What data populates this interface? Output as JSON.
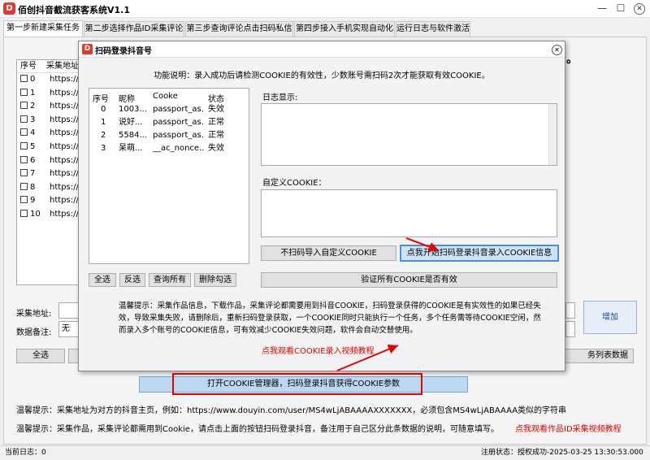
{
  "app": {
    "icon_letter": "D",
    "title": "佰创抖音截流获客系统V1.1"
  },
  "window_controls": {
    "minimize": "—",
    "maximize": "☐",
    "close": "✕"
  },
  "tabs": [
    {
      "label": "第一步新建采集任务",
      "active": true
    },
    {
      "label": "第二步选择作品ID采集评论",
      "active": false
    },
    {
      "label": "第三步查询评论点击扫码私信",
      "active": false
    },
    {
      "label": "第四步接入手机实现自动化",
      "active": false
    },
    {
      "label": "运行日志与软件激活",
      "active": false
    }
  ],
  "background": {
    "list_header": {
      "col_index": "序号",
      "col_url": "采集地址"
    },
    "list_rows": [
      {
        "index": "0",
        "url": "https://\\"
      },
      {
        "index": "1",
        "url": "https://\\"
      },
      {
        "index": "2",
        "url": "https://\\"
      },
      {
        "index": "3",
        "url": "https://\\"
      },
      {
        "index": "4",
        "url": "https://\\"
      },
      {
        "index": "5",
        "url": "https://\\"
      },
      {
        "index": "6",
        "url": "https://\\"
      },
      {
        "index": "7",
        "url": "https://\\"
      },
      {
        "index": "8",
        "url": "https://\\"
      },
      {
        "index": "9",
        "url": "https://\\"
      },
      {
        "index": "10",
        "url": "https://\\"
      }
    ],
    "dot": "。",
    "url_label": "采集地址:",
    "note_label": "数据备注:",
    "note_value": "无",
    "select_all": "全选",
    "list_data_button": "务列表数据",
    "add_button": "增加",
    "open_cookie_button": "打开COOKIE管理器，扫码登录抖音获得COOKIE参数",
    "hint1": "温馨提示：采集地址为对方的抖音主页，例如：https://www.douyin.com/user/MS4wLjABAAAAXXXXXXX，必须包含MS4wLjABAAAA类似的字符串",
    "hint2": "温馨提示：采集作品，采集评论都需用到Cookie，请点击上面的按钮扫码登录抖音，备注用于自己区分此条数据的说明，可随意填写。",
    "video_link": "点我观看作品ID采集视频教程"
  },
  "statusbar": {
    "left": "当前日志：0",
    "right": "注册状态：授权成功-2025-03-25 13:30:53.000"
  },
  "dialog": {
    "icon_letter": "D",
    "title": "扫码登录抖音号",
    "close": "✕",
    "description": "功能说明：录入成功后请检测COOKIE的有效性，少数账号需扫码2次才能获取有效COOKIE。",
    "table_header": {
      "index": "序号",
      "nickname": "昵称",
      "cookie": "Cooke",
      "status": "状态"
    },
    "accounts": [
      {
        "index": "0",
        "nickname": "1003...",
        "cookie": "passport_as...",
        "status": "失效"
      },
      {
        "index": "1",
        "nickname": "说好...",
        "cookie": "passport_as...",
        "status": "正常"
      },
      {
        "index": "2",
        "nickname": "5584...",
        "cookie": "passport_as...",
        "status": "正常"
      },
      {
        "index": "3",
        "nickname": "呆萌...",
        "cookie": "__ac_nonce...",
        "status": "失效"
      }
    ],
    "log_label": "日志显示:",
    "cookie_label": "自定义COOKIE：",
    "no_scan_button": "不扫码导入自定义COOKIE",
    "scan_button": "点我开始扫码登录抖音录入COOKIE信息",
    "verify_button": "验证所有COOKIE是否有效",
    "select_all": "全选",
    "invert": "反选",
    "query_all": "查询所有",
    "delete_checked": "删除勾选",
    "tip": "温馨提示：采集作品信息，下载作品，采集评论都需要用到抖音COOKIE，扫码登录获得的COOKIE是有实效性的如果已经失效，导致采集失败，请删除后，重新扫码登录获取，一个COOKIE同时只能执行一个任务，多个任务需等待COOKIE空闲，然而录入多个账号的COOKIE信息，可有效减少COOKIE失效问题，软件会自动交替使用。",
    "video_link": "点我观看COOKIE录入视频教程"
  },
  "accent_colors": {
    "red_annotation": "#e60000",
    "primary_blue": "#4a8fd8"
  }
}
